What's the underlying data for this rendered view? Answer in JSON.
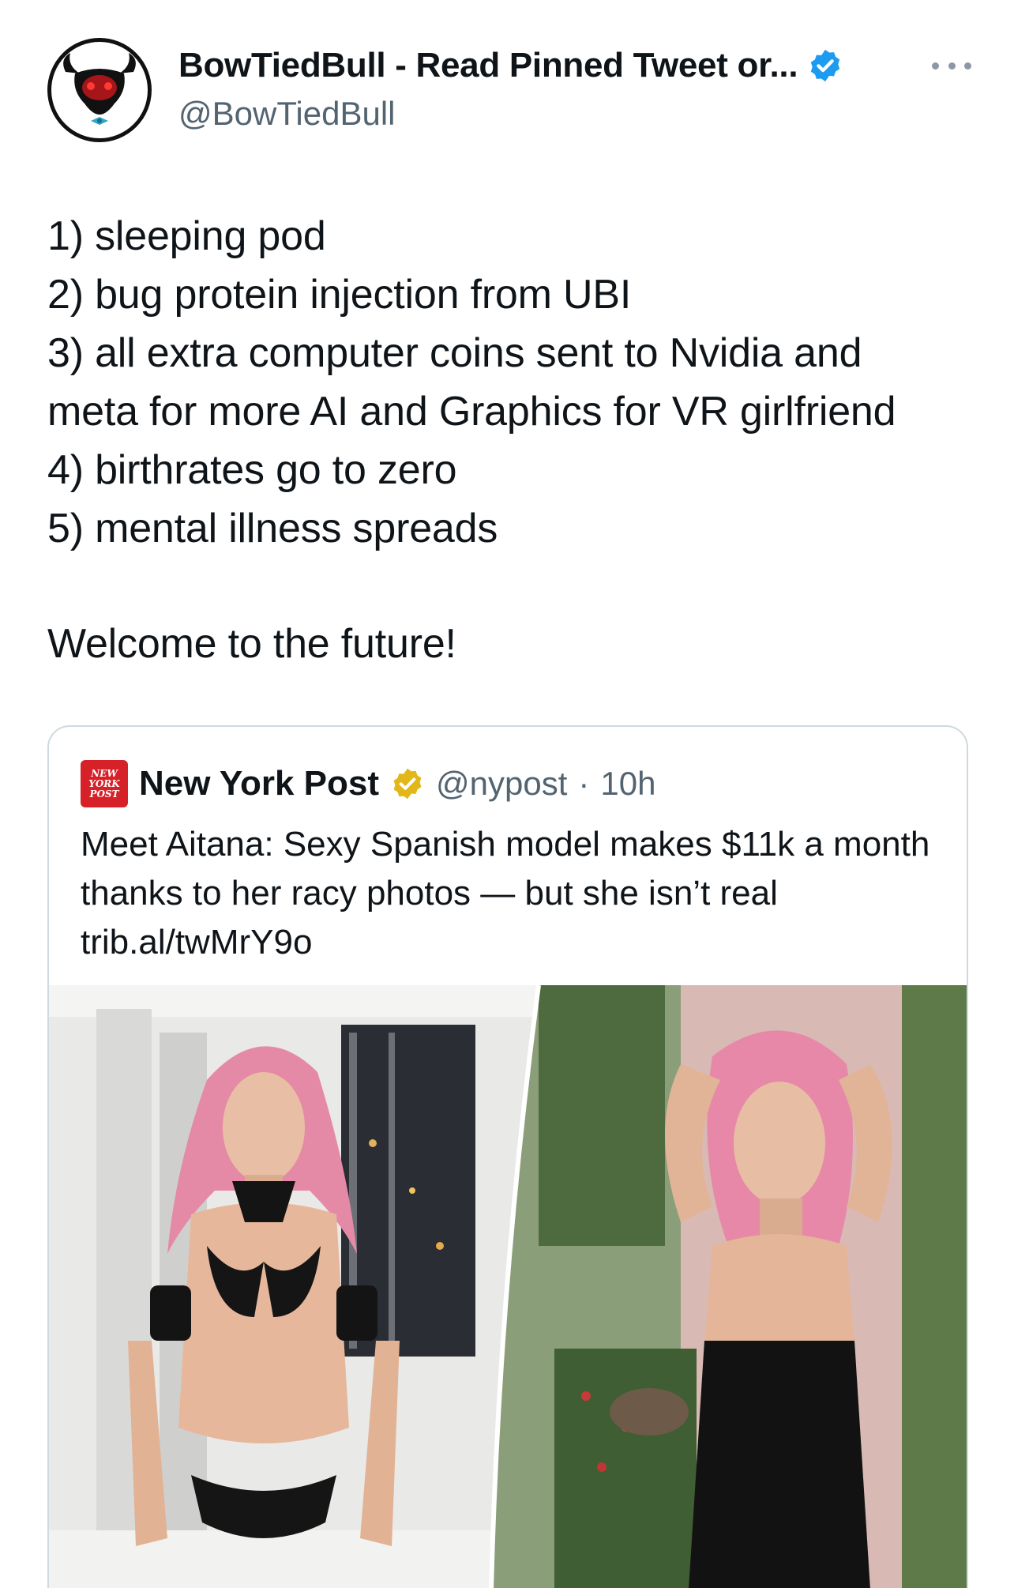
{
  "tweet": {
    "author": {
      "display_name": "BowTiedBull - Read Pinned Tweet or...",
      "handle": "@BowTiedBull",
      "verified_color": "#1d9bf0",
      "avatar_icon": "bull-head-icon"
    },
    "body_lines": [
      "1) sleeping pod",
      "2) bug protein injection from UBI",
      "3) all extra computer coins sent to Nvidia and",
      "meta for more AI and Graphics for VR girlfriend",
      "4) birthrates go to zero",
      "5) mental illness spreads"
    ],
    "closing": "Welcome to the future!"
  },
  "quoted": {
    "display_name": "New York Post",
    "logo_text": [
      "NEW",
      "YORK",
      "POST"
    ],
    "handle": "@nypost",
    "separator": "·",
    "time": "10h",
    "text": "Meet Aitana: Sexy Spanish model makes $11k a month thanks to her racy photos — but she isn’t real trib.al/twMrY9o",
    "badge_color": "#e2b719",
    "brand_color": "#d62128"
  }
}
